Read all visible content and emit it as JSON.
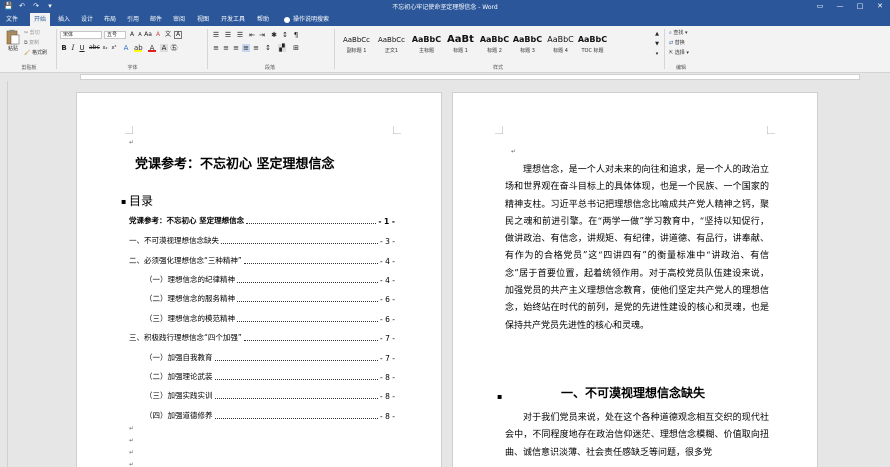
{
  "window": {
    "title": "不忘初心牢记使命坚定理想信念 - Word"
  },
  "qat": {
    "save": "💾",
    "undo": "↶",
    "redo": "↷",
    "customize": "▾"
  },
  "winctl": {
    "restore": "▭",
    "minimize": "—",
    "maximize": "□",
    "close": "✕"
  },
  "tabs": [
    {
      "label": "文件"
    },
    {
      "label": "开始"
    },
    {
      "label": "插入"
    },
    {
      "label": "设计"
    },
    {
      "label": "布局"
    },
    {
      "label": "引用"
    },
    {
      "label": "邮件"
    },
    {
      "label": "审阅"
    },
    {
      "label": "视图"
    },
    {
      "label": "开发工具"
    },
    {
      "label": "帮助"
    }
  ],
  "tell_me": "操作说明搜索",
  "ribbon": {
    "clipboard": {
      "paste": "粘贴",
      "cut": "剪切",
      "copy": "复制",
      "format_painter": "格式刷",
      "label": "剪贴板"
    },
    "font": {
      "name": "宋体",
      "size": "五号",
      "label": "字体",
      "bold": "B",
      "italic": "I",
      "underline": "U"
    },
    "paragraph": {
      "label": "段落"
    },
    "styles": {
      "label": "样式",
      "items": [
        {
          "preview": "AaBbCc",
          "name": "副标题 1"
        },
        {
          "preview": "AaBbCc",
          "name": "正文1"
        },
        {
          "preview": "AaBbC",
          "name": "主标题"
        },
        {
          "preview": "AaBt",
          "name": "标题 1"
        },
        {
          "preview": "AaBbC",
          "name": "标题 2"
        },
        {
          "preview": "AaBbC",
          "name": "标题 3"
        },
        {
          "preview": "AaBbC",
          "name": "标题 4"
        },
        {
          "preview": "AaBbC",
          "name": "TOC 标题"
        }
      ]
    },
    "editing": {
      "find": "查找",
      "replace": "替换",
      "select": "选择",
      "label": "编辑"
    }
  },
  "left_page": {
    "title": "党课参考：不忘初心  坚定理想信念",
    "toc_heading": "目录",
    "toc": [
      {
        "text": "党课参考：不忘初心  坚定理想信念",
        "page": "- 1 -"
      },
      {
        "text": "一、不可漠视理想信念缺失",
        "page": "- 3 -"
      },
      {
        "text": "二、必须强化理想信念“三种精神”",
        "page": "- 4 -"
      },
      {
        "text": "（一）理想信念的纪律精神",
        "page": "- 4 -"
      },
      {
        "text": "（二）理想信念的服务精神",
        "page": "- 6 -"
      },
      {
        "text": "（三）理想信念的模范精神",
        "page": "- 6 -"
      },
      {
        "text": "三、积极践行理想信念“四个加强”",
        "page": "- 7 -"
      },
      {
        "text": "（一）加强自我教育",
        "page": "- 7 -"
      },
      {
        "text": "（二）加强理论武装",
        "page": "- 8 -"
      },
      {
        "text": "（三）加强实践实训",
        "page": "- 8 -"
      },
      {
        "text": "（四）加强道德修养",
        "page": "- 8 -"
      }
    ]
  },
  "right_page": {
    "para1": "理想信念，是一个人对未来的向往和追求，是一个人的政治立场和世界观在奋斗目标上的具体体现，也是一个民族、一个国家的精神支柱。习近平总书记把理想信念比喻成共产党人精神之钙，聚民之魂和前进引擎。在“两学一做”学习教育中，“坚持以知促行，做讲政治、有信念，讲规矩、有纪律，讲道德、有品行，讲奉献、有作为的合格党员”这“四讲四有”的衡量标准中“讲政治、有信念”居于首要位置，起着统领作用。对于高校党员队伍建设来说，加强党员的共产主义理想信念教育，使他们坚定共产党人的理想信念，始终站在时代的前列，是党的先进性建设的核心和灵魂，也是保持共产党员先进性的核心和灵魂。",
    "heading": "一、不可漠视理想信念缺失",
    "para2": "对于我们党员来说，处在这个各种道德观念相互交织的现代社会中，不同程度地存在政治信仰迷茫、理想信念模糊、价值取向扭曲、诚信意识淡薄、社会责任感缺乏等问题，很多党"
  }
}
